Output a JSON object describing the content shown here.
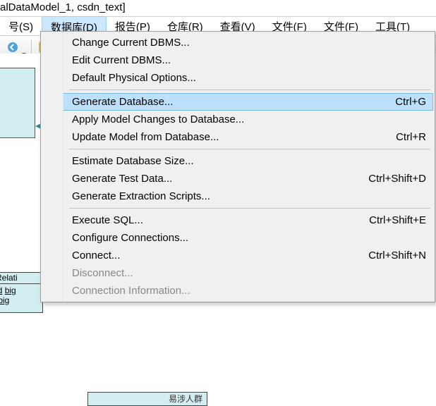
{
  "title_fragment": "alDataModel_1, csdn_text]",
  "menubar": {
    "items": [
      {
        "label": "号(S)"
      },
      {
        "label": "数据库(D)"
      },
      {
        "label": "报告(P)"
      },
      {
        "label": "仓库(R)"
      },
      {
        "label": "查看(V)"
      },
      {
        "label": "文件(F)"
      },
      {
        "label": "文件(F)"
      },
      {
        "label": "工具(T)"
      }
    ],
    "active_index": 1
  },
  "toolbar": {
    "icons": [
      "back-icon",
      "forward-icon",
      "db-container-icon"
    ]
  },
  "side_box": {
    "header": "Relati",
    "row1_left": "id",
    "row1_right": "big",
    "row2_left": "",
    "row2_right": "big"
  },
  "small_box_fragment": "易涉人群",
  "dropdown": {
    "groups": [
      [
        {
          "label": "Change Current DBMS...",
          "shortcut": "",
          "state": "normal"
        },
        {
          "label": "Edit Current DBMS...",
          "shortcut": "",
          "state": "normal"
        },
        {
          "label": "Default Physical Options...",
          "shortcut": "",
          "state": "normal"
        }
      ],
      [
        {
          "label": "Generate Database...",
          "shortcut": "Ctrl+G",
          "state": "hover"
        },
        {
          "label": "Apply Model Changes to Database...",
          "shortcut": "",
          "state": "normal"
        },
        {
          "label": "Update Model from Database...",
          "shortcut": "Ctrl+R",
          "state": "normal"
        }
      ],
      [
        {
          "label": "Estimate Database Size...",
          "shortcut": "",
          "state": "normal"
        },
        {
          "label": "Generate Test Data...",
          "shortcut": "Ctrl+Shift+D",
          "state": "normal"
        },
        {
          "label": "Generate Extraction Scripts...",
          "shortcut": "",
          "state": "normal"
        }
      ],
      [
        {
          "label": "Execute SQL...",
          "shortcut": "Ctrl+Shift+E",
          "state": "normal"
        },
        {
          "label": "Configure Connections...",
          "shortcut": "",
          "state": "normal"
        },
        {
          "label": "Connect...",
          "shortcut": "Ctrl+Shift+N",
          "state": "normal"
        },
        {
          "label": "Disconnect...",
          "shortcut": "",
          "state": "disabled"
        },
        {
          "label": "Connection Information...",
          "shortcut": "",
          "state": "disabled"
        }
      ]
    ]
  }
}
